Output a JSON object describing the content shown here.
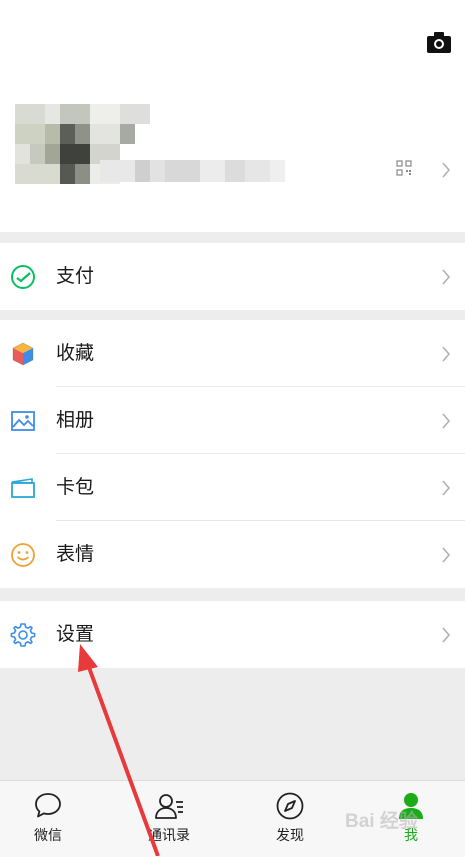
{
  "menu": {
    "pay": {
      "label": "支付"
    },
    "favorites": {
      "label": "收藏"
    },
    "album": {
      "label": "相册"
    },
    "card": {
      "label": "卡包"
    },
    "sticker": {
      "label": "表情"
    },
    "settings": {
      "label": "设置"
    }
  },
  "tabbar": {
    "tabs": [
      {
        "label": "微信",
        "icon": "chat-bubble-icon"
      },
      {
        "label": "通讯录",
        "icon": "contacts-icon"
      },
      {
        "label": "发现",
        "icon": "compass-icon"
      },
      {
        "label": "我",
        "icon": "me-icon",
        "active": true
      }
    ]
  },
  "watermark": {
    "text": "Bai 经验"
  },
  "colors": {
    "accent": "#1aad19",
    "pay_green": "#07c160",
    "blue": "#3d8ee6",
    "arrow_red": "#e83a3a"
  }
}
